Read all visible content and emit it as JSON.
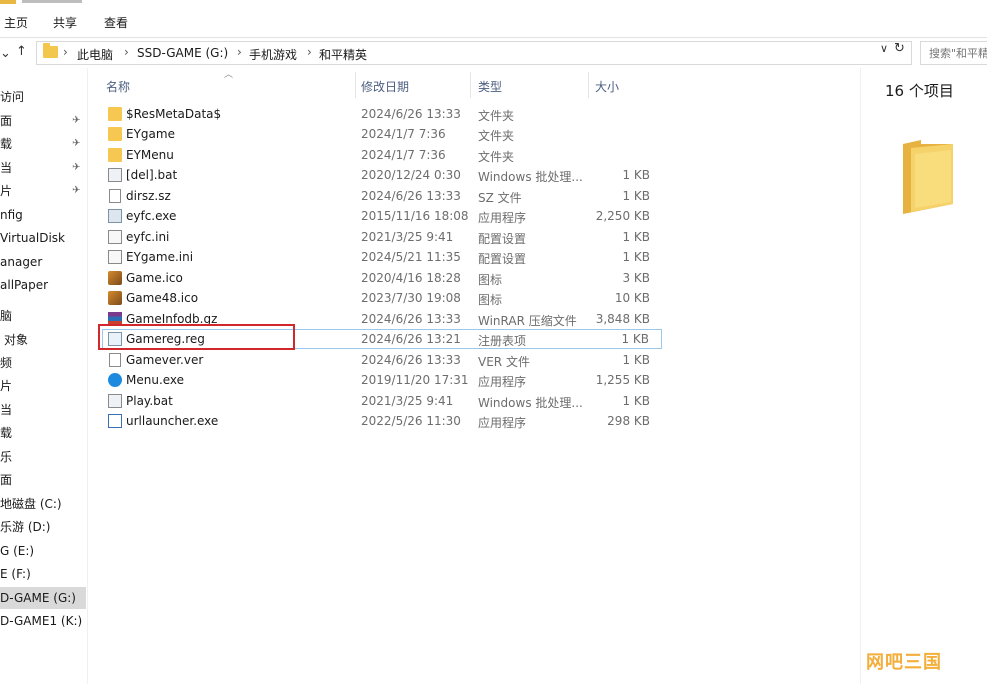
{
  "ribbon": {
    "tabs": [
      "主页",
      "共享",
      "查看"
    ]
  },
  "address": {
    "crumbs": [
      "此电脑",
      "SSD-GAME (G:)",
      "手机游戏",
      "和平精英"
    ],
    "search_placeholder": "搜索\"和平精"
  },
  "nav": {
    "items": [
      {
        "label": "访问",
        "pinned": false
      },
      {
        "label": "面",
        "pinned": true
      },
      {
        "label": "载",
        "pinned": true
      },
      {
        "label": "当",
        "pinned": true
      },
      {
        "label": "片",
        "pinned": true
      },
      {
        "label": "nfig",
        "pinned": false
      },
      {
        "label": "VirtualDisk",
        "pinned": false
      },
      {
        "label": "anager",
        "pinned": false
      },
      {
        "label": "allPaper",
        "pinned": false
      },
      {
        "label": "脑",
        "pinned": false
      },
      {
        "label": "对象",
        "pinned": false
      },
      {
        "label": "频",
        "pinned": false
      },
      {
        "label": "片",
        "pinned": false
      },
      {
        "label": "当",
        "pinned": false
      },
      {
        "label": "载",
        "pinned": false
      },
      {
        "label": "乐",
        "pinned": false
      },
      {
        "label": "面",
        "pinned": false
      },
      {
        "label": "地磁盘 (C:)",
        "pinned": false
      },
      {
        "label": "乐游 (D:)",
        "pinned": false
      },
      {
        "label": "G (E:)",
        "pinned": false
      },
      {
        "label": "E (F:)",
        "pinned": false
      },
      {
        "label": "D-GAME (G:)",
        "pinned": false,
        "selected": true
      },
      {
        "label": "D-GAME1 (K:)",
        "pinned": false
      }
    ]
  },
  "columns": {
    "name": "名称",
    "date": "修改日期",
    "type": "类型",
    "size": "大小"
  },
  "files": [
    {
      "name": "$ResMetaData$",
      "date": "2024/6/26 13:33",
      "type": "文件夹",
      "size": "",
      "icon": "folder"
    },
    {
      "name": "EYgame",
      "date": "2024/1/7 7:36",
      "type": "文件夹",
      "size": "",
      "icon": "folder"
    },
    {
      "name": "EYMenu",
      "date": "2024/1/7 7:36",
      "type": "文件夹",
      "size": "",
      "icon": "folder"
    },
    {
      "name": "[del].bat",
      "date": "2020/12/24 0:30",
      "type": "Windows 批处理...",
      "size": "1 KB",
      "icon": "bat"
    },
    {
      "name": "dirsz.sz",
      "date": "2024/6/26 13:33",
      "type": "SZ 文件",
      "size": "1 KB",
      "icon": "file"
    },
    {
      "name": "eyfc.exe",
      "date": "2015/11/16 18:08",
      "type": "应用程序",
      "size": "2,250 KB",
      "icon": "exe"
    },
    {
      "name": "eyfc.ini",
      "date": "2021/3/25 9:41",
      "type": "配置设置",
      "size": "1 KB",
      "icon": "ini"
    },
    {
      "name": "EYgame.ini",
      "date": "2024/5/21 11:35",
      "type": "配置设置",
      "size": "1 KB",
      "icon": "ini"
    },
    {
      "name": "Game.ico",
      "date": "2020/4/16 18:28",
      "type": "图标",
      "size": "3 KB",
      "icon": "ico"
    },
    {
      "name": "Game48.ico",
      "date": "2023/7/30 19:08",
      "type": "图标",
      "size": "10 KB",
      "icon": "ico"
    },
    {
      "name": "GameInfodb.gz",
      "date": "2024/6/26 13:33",
      "type": "WinRAR 压缩文件",
      "size": "3,848 KB",
      "icon": "gz"
    },
    {
      "name": "Gamereg.reg",
      "date": "2024/6/26 13:21",
      "type": "注册表项",
      "size": "1 KB",
      "icon": "reg",
      "selected": true
    },
    {
      "name": "Gamever.ver",
      "date": "2024/6/26 13:33",
      "type": "VER 文件",
      "size": "1 KB",
      "icon": "file"
    },
    {
      "name": "Menu.exe",
      "date": "2019/11/20 17:31",
      "type": "应用程序",
      "size": "1,255 KB",
      "icon": "menu"
    },
    {
      "name": "Play.bat",
      "date": "2021/3/25 9:41",
      "type": "Windows 批处理...",
      "size": "1 KB",
      "icon": "bat"
    },
    {
      "name": "urllauncher.exe",
      "date": "2022/5/26 11:30",
      "type": "应用程序",
      "size": "298 KB",
      "icon": "url"
    }
  ],
  "details": {
    "count": "16 个项目"
  },
  "watermark": "网吧三国",
  "colors": {
    "header_text": "#4c5f80",
    "highlight_box": "#d1282c",
    "folder": "#f6c852",
    "selection_border": "#99c8ee"
  }
}
